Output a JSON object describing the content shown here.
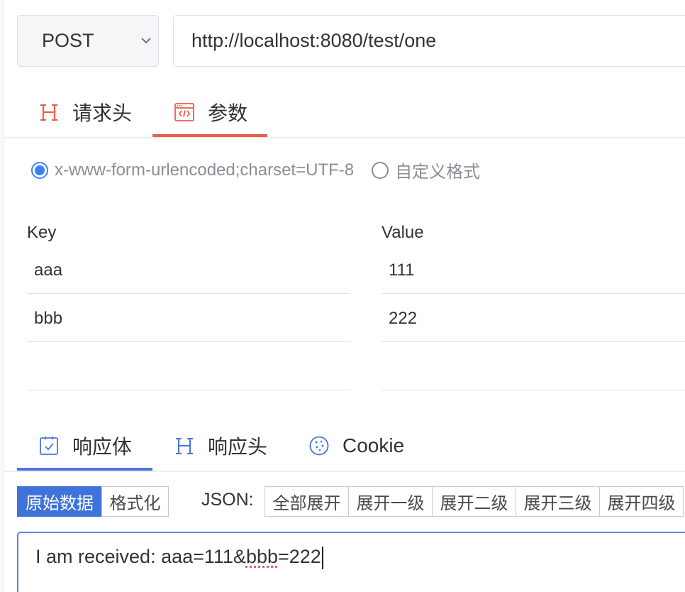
{
  "request": {
    "method": "POST",
    "url": "http://localhost:8080/test/one"
  },
  "request_tabs": [
    {
      "label": "请求头",
      "icon": "heading-icon",
      "active": false
    },
    {
      "label": "参数",
      "icon": "code-window-icon",
      "active": true
    }
  ],
  "content_type": {
    "options": [
      {
        "label": "x-www-form-urlencoded;charset=UTF-8",
        "checked": true
      },
      {
        "label": "自定义格式",
        "checked": false
      }
    ]
  },
  "params": {
    "key_header": "Key",
    "value_header": "Value",
    "rows": [
      {
        "key": "aaa",
        "value": "111"
      },
      {
        "key": "bbb",
        "value": "222"
      },
      {
        "key": "",
        "value": ""
      }
    ]
  },
  "response_tabs": [
    {
      "label": "响应体",
      "icon": "checkbox-icon",
      "active": true
    },
    {
      "label": "响应头",
      "icon": "heading-icon",
      "active": false
    },
    {
      "label": "Cookie",
      "icon": "cookie-icon",
      "active": false
    }
  ],
  "view_buttons": {
    "raw": "原始数据",
    "formatted": "格式化"
  },
  "json_label": "JSON:",
  "json_buttons": [
    "全部展开",
    "展开一级",
    "展开二级",
    "展开三级",
    "展开四级"
  ],
  "response_body": {
    "prefix": "I am received: aaa=111&",
    "misspelled": "bbb",
    "suffix": "=222"
  },
  "colors": {
    "request_accent": "#f05a4a",
    "response_accent": "#4a74e0",
    "radio_checked": "#3c82f6",
    "primary_button": "#3f73da"
  }
}
